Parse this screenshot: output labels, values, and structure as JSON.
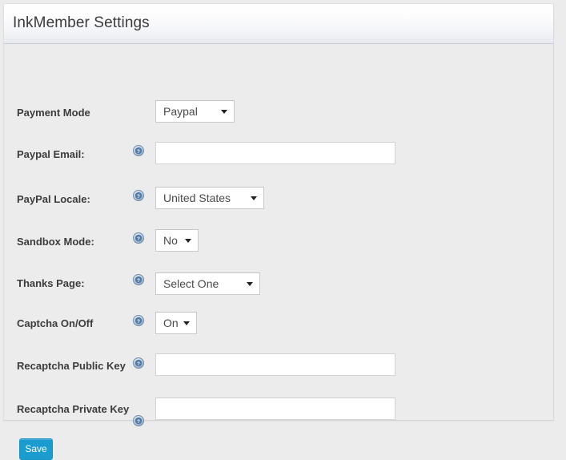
{
  "panel": {
    "title": "InkMember Settings"
  },
  "help_icon_name": "help-question-icon",
  "fields": [
    {
      "key": "payment_mode",
      "label": "Payment Mode",
      "has_help": false,
      "control": "select",
      "value": "Paypal"
    },
    {
      "key": "paypal_email",
      "label": "Paypal Email:",
      "has_help": true,
      "control": "text",
      "value": "",
      "placeholder": ""
    },
    {
      "key": "paypal_locale",
      "label": "PayPal Locale:",
      "has_help": true,
      "control": "select",
      "value": "United States"
    },
    {
      "key": "sandbox_mode",
      "label": "Sandbox Mode:",
      "has_help": true,
      "control": "select",
      "value": "No"
    },
    {
      "key": "thanks_page",
      "label": "Thanks Page:",
      "has_help": true,
      "control": "select",
      "value": "Select One"
    },
    {
      "key": "captcha_on_off",
      "label": "Captcha On/Off",
      "has_help": true,
      "control": "select",
      "value": "On"
    },
    {
      "key": "recaptcha_public_key",
      "label": "Recaptcha Public Key",
      "has_help": true,
      "control": "text",
      "value": "",
      "placeholder": ""
    },
    {
      "key": "recaptcha_private_key",
      "label": "Recaptcha Private Key",
      "has_help": true,
      "control": "text",
      "value": "",
      "placeholder": ""
    }
  ],
  "save_button": {
    "label": "Save"
  },
  "colors": {
    "accent": "#1b9cd0",
    "page_background": "#ececec",
    "panel_border": "#dfdfdf",
    "label_text": "#3c3c3c",
    "help_icon": "#5b7fa6"
  }
}
